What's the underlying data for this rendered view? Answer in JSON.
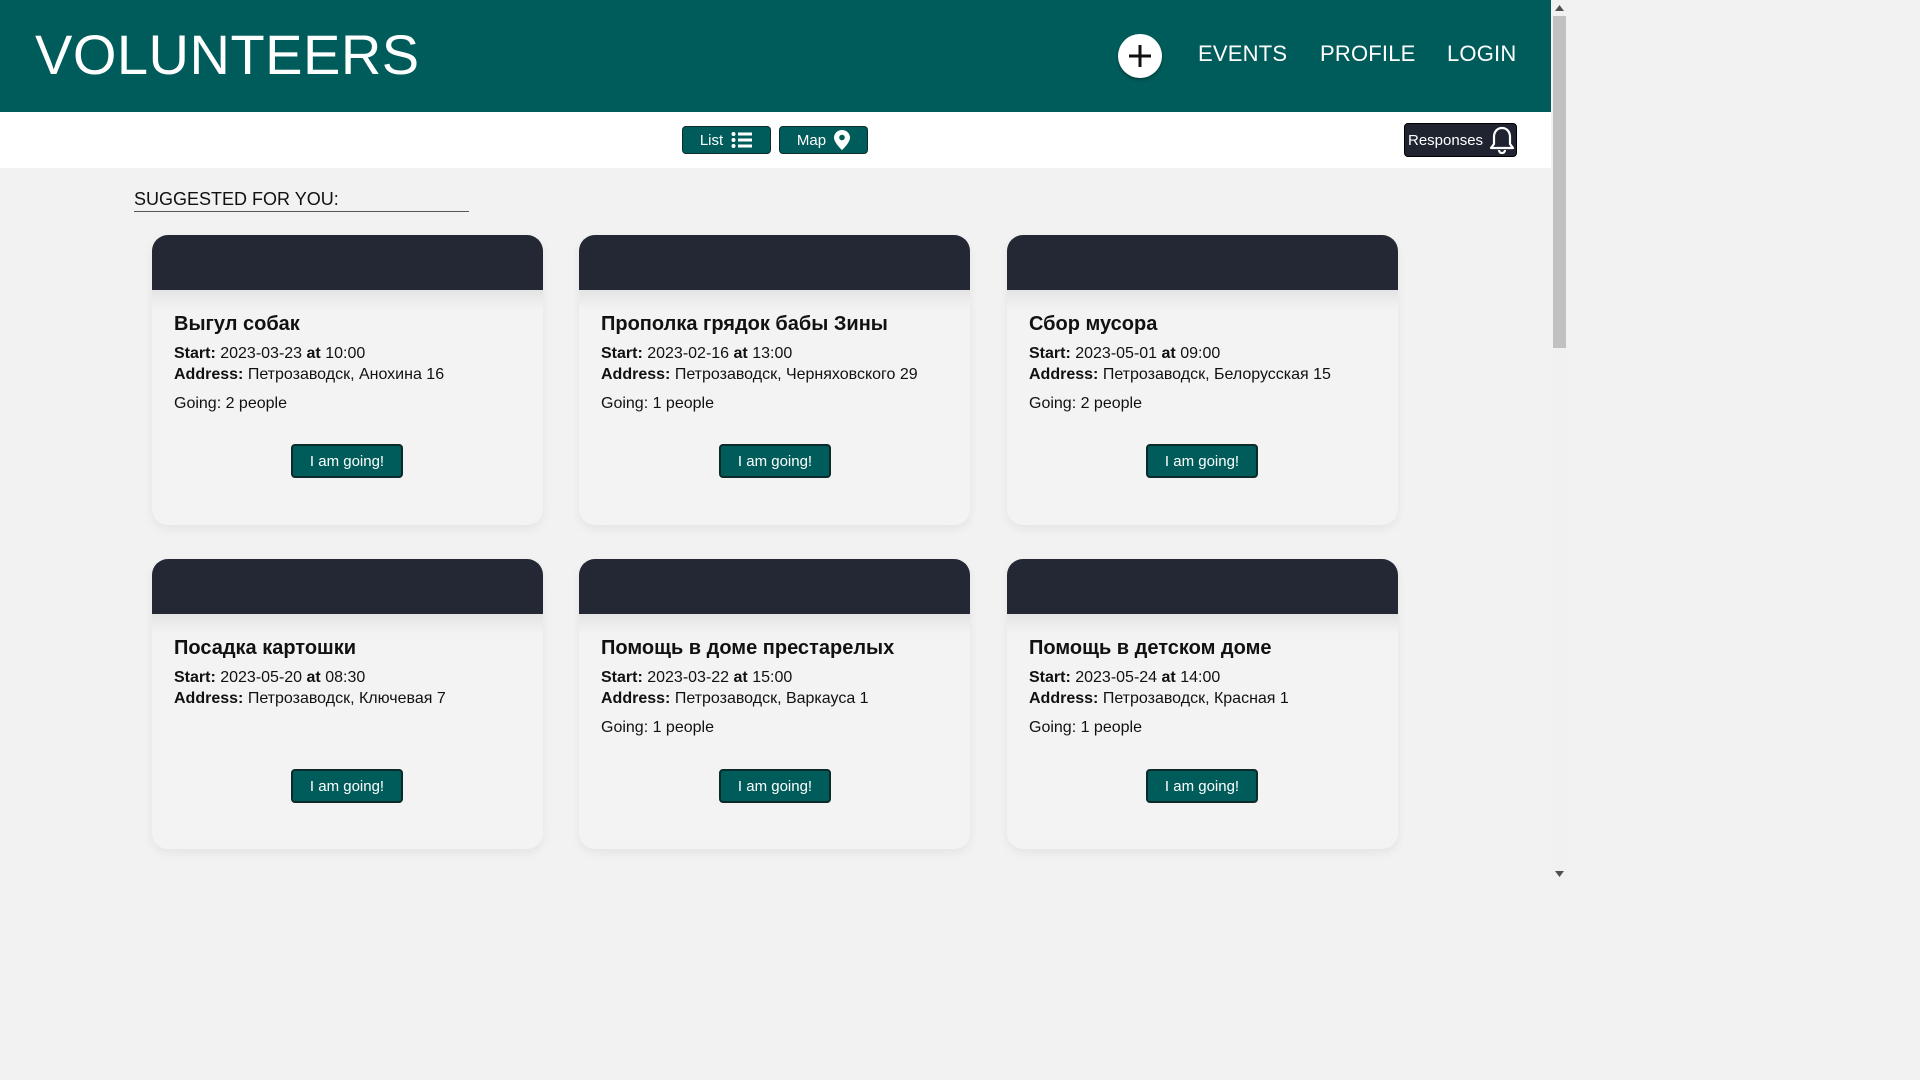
{
  "header": {
    "logo": "VOLUNTEERS",
    "nav": [
      "EVENTS",
      "PROFILE",
      "LOGIN"
    ]
  },
  "toolbar": {
    "list_label": "List",
    "map_label": "Map",
    "responses_label": "Responses"
  },
  "section_title": "SUGGESTED FOR YOU:",
  "labels": {
    "start": "Start:",
    "at": "at",
    "address": "Address:"
  },
  "events": [
    {
      "title": "Выгул собак",
      "date": "2023-03-23",
      "time": "10:00",
      "address": "Петрозаводск, Анохина 16",
      "going": "Going: 2 people",
      "button": "I am going!"
    },
    {
      "title": "Прополка грядок бабы Зины",
      "date": "2023-02-16",
      "time": "13:00",
      "address": "Петрозаводск, Черняховского 29",
      "going": "Going: 1 people",
      "button": "I am going!"
    },
    {
      "title": "Сбор мусора",
      "date": "2023-05-01",
      "time": "09:00",
      "address": "Петрозаводск, Белорусская 15",
      "going": "Going: 2 people",
      "button": "I am going!"
    },
    {
      "title": "Посадка картошки",
      "date": "2023-05-20",
      "time": "08:30",
      "address": "Петрозаводск, Ключевая 7",
      "going": "",
      "button": "I am going!"
    },
    {
      "title": "Помощь в доме престарелых",
      "date": "2023-03-22",
      "time": "15:00",
      "address": "Петрозаводск, Варкауса 1",
      "going": "Going: 1 people",
      "button": "I am going!"
    },
    {
      "title": "Помощь в детском доме",
      "date": "2023-05-24",
      "time": "14:00",
      "address": "Петрозаводск, Красная 1",
      "going": "Going: 1 people",
      "button": "I am going!"
    }
  ],
  "colors": {
    "header_bg": "#005c5a",
    "card_top": "#232834",
    "button_bg": "#005c5a"
  },
  "icons": [
    "plus-icon",
    "list-icon",
    "map-pin-icon",
    "bell-icon"
  ]
}
